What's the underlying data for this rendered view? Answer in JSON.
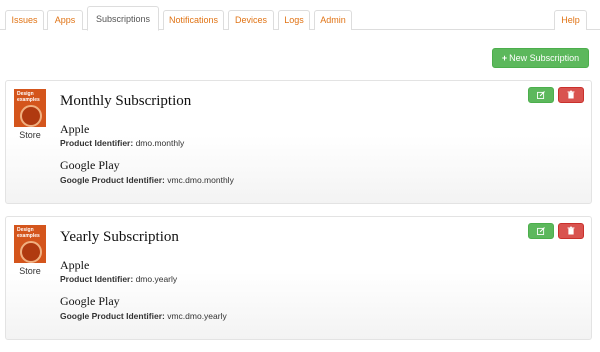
{
  "tabs": [
    {
      "label": "Issues",
      "active": false
    },
    {
      "label": "Apps",
      "active": false
    },
    {
      "label": "Subscriptions",
      "active": true
    },
    {
      "label": "Notifications",
      "active": false
    },
    {
      "label": "Devices",
      "active": false
    },
    {
      "label": "Logs",
      "active": false
    },
    {
      "label": "Admin",
      "active": false
    }
  ],
  "help_label": "Help",
  "new_button": {
    "plus": "+",
    "label": "New Subscription"
  },
  "store_thumb": {
    "line1": "Design",
    "line2": "examples"
  },
  "subscriptions": [
    {
      "title": "Monthly Subscription",
      "store_label": "Store",
      "apple": {
        "heading": "Apple",
        "label": "Product Identifier:",
        "value": "dmo.monthly"
      },
      "google": {
        "heading": "Google Play",
        "label": "Google Product Identifier:",
        "value": "vmc.dmo.monthly"
      }
    },
    {
      "title": "Yearly Subscription",
      "store_label": "Store",
      "apple": {
        "heading": "Apple",
        "label": "Product Identifier:",
        "value": "dmo.yearly"
      },
      "google": {
        "heading": "Google Play",
        "label": "Google Product Identifier:",
        "value": "vmc.dmo.yearly"
      }
    }
  ],
  "colors": {
    "accent": "#e07314",
    "success": "#5cb85c",
    "danger": "#d9534f"
  },
  "icons": {
    "edit": "edit-icon",
    "delete": "trash-icon"
  }
}
